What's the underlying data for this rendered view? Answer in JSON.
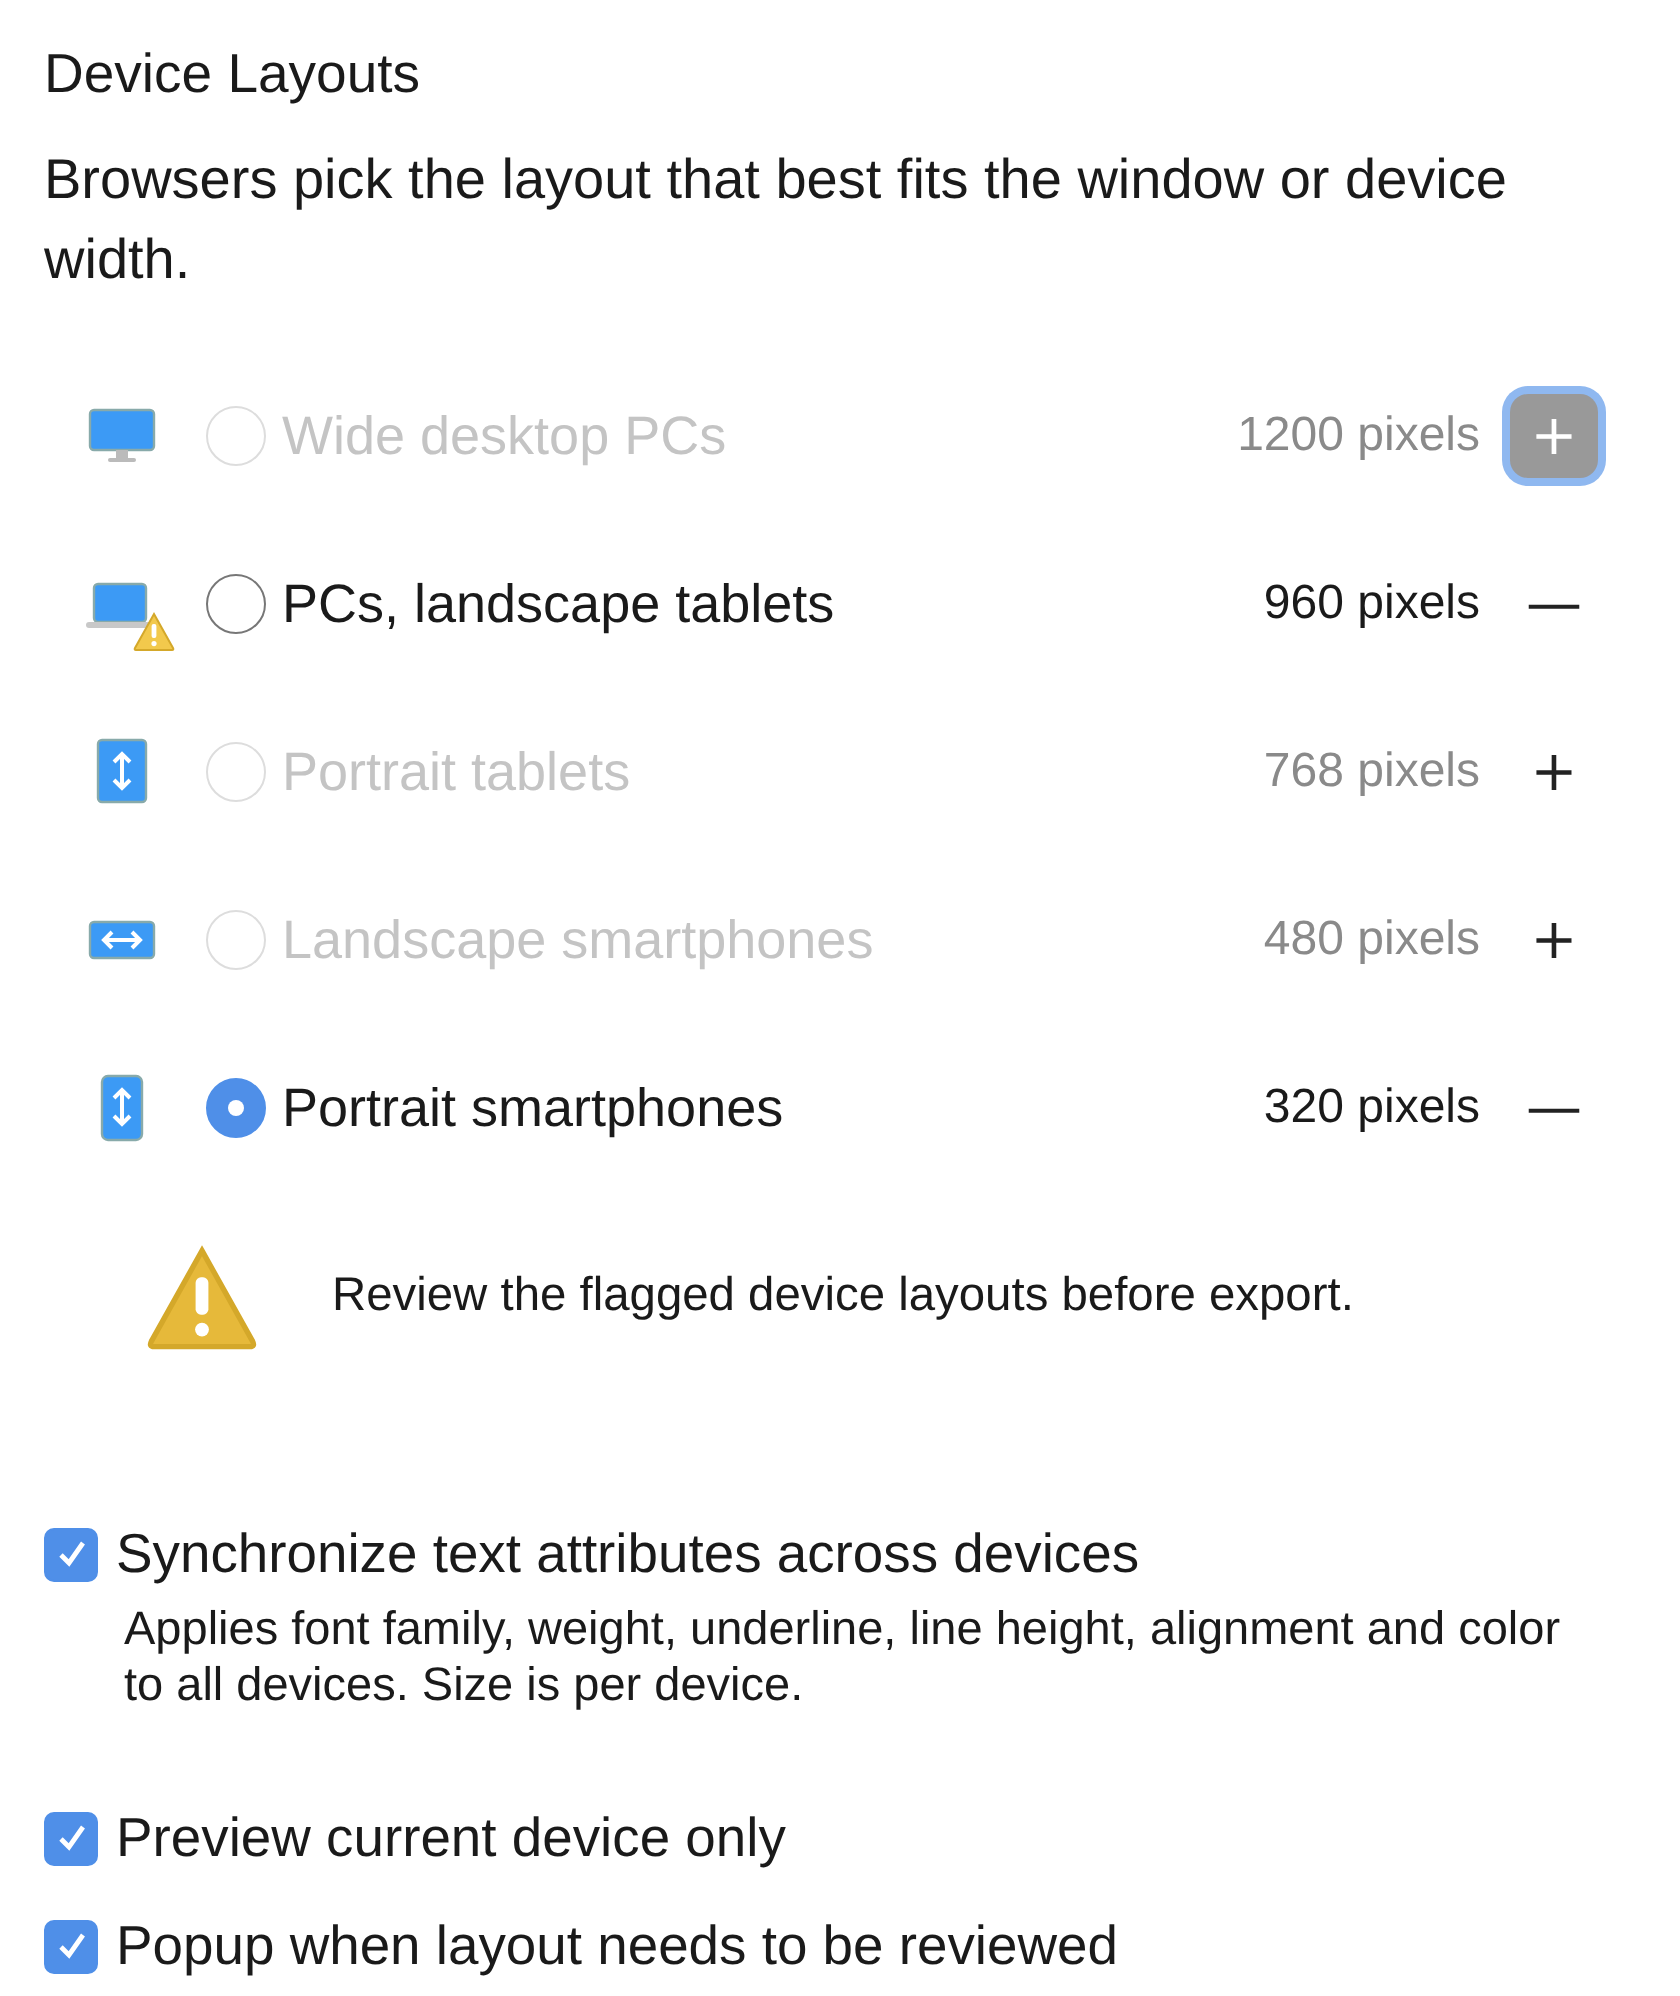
{
  "title": "Device Layouts",
  "description": "Browsers pick the layout that best fits the window or device width.",
  "layouts": [
    {
      "kind": "desktop",
      "label": "Wide desktop PCs",
      "enabled": false,
      "selected": false,
      "warning": false,
      "width": "1200 pixels",
      "action": "+",
      "focused": true
    },
    {
      "kind": "laptop",
      "label": "PCs, landscape tablets",
      "enabled": true,
      "selected": false,
      "warning": true,
      "width": "960 pixels",
      "action": "—",
      "focused": false
    },
    {
      "kind": "tablet",
      "label": "Portrait tablets",
      "enabled": false,
      "selected": false,
      "warning": false,
      "width": "768 pixels",
      "action": "+",
      "focused": false
    },
    {
      "kind": "phone-landscape",
      "label": "Landscape smartphones",
      "enabled": false,
      "selected": false,
      "warning": false,
      "width": "480 pixels",
      "action": "+",
      "focused": false
    },
    {
      "kind": "phone",
      "label": "Portrait smartphones",
      "enabled": true,
      "selected": true,
      "warning": false,
      "width": "320 pixels",
      "action": "—",
      "focused": false
    }
  ],
  "alert": "Review the flagged device layouts before export.",
  "options": [
    {
      "label": "Synchronize text attributes across devices",
      "checked": true,
      "note": "Applies font family, weight, underline, line height, alignment and color to all devices. Size is per device."
    },
    {
      "label": "Preview current device only",
      "checked": true
    },
    {
      "label": "Popup when layout needs to be reviewed",
      "checked": true
    }
  ]
}
